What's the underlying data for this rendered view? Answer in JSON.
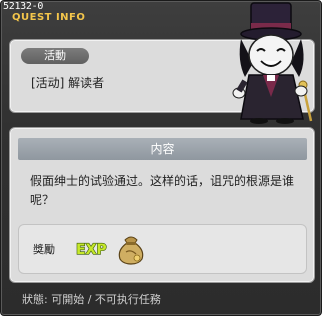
{
  "window": {
    "quest_id": "52132-0",
    "title": "QUEST INFO"
  },
  "info": {
    "category": "活動",
    "quest_name": "[活动] 解读者"
  },
  "content": {
    "header": "内容",
    "description": "假面绅士的试验通过。这样的话，诅咒的根源是谁呢？"
  },
  "reward": {
    "label": "獎勵",
    "exp_text": "EXP",
    "items": [
      "exp-icon",
      "money-bag-icon"
    ]
  },
  "status": {
    "label": "狀態",
    "value": "可開始",
    "separator": "/",
    "note": "不可执行任務"
  },
  "colors": {
    "title": "#f4c64b",
    "window_bg": "#333333",
    "panel_bg": "#dcdcdc",
    "header_bg": "#9aa2aa",
    "exp_green": "#c6e82a"
  }
}
